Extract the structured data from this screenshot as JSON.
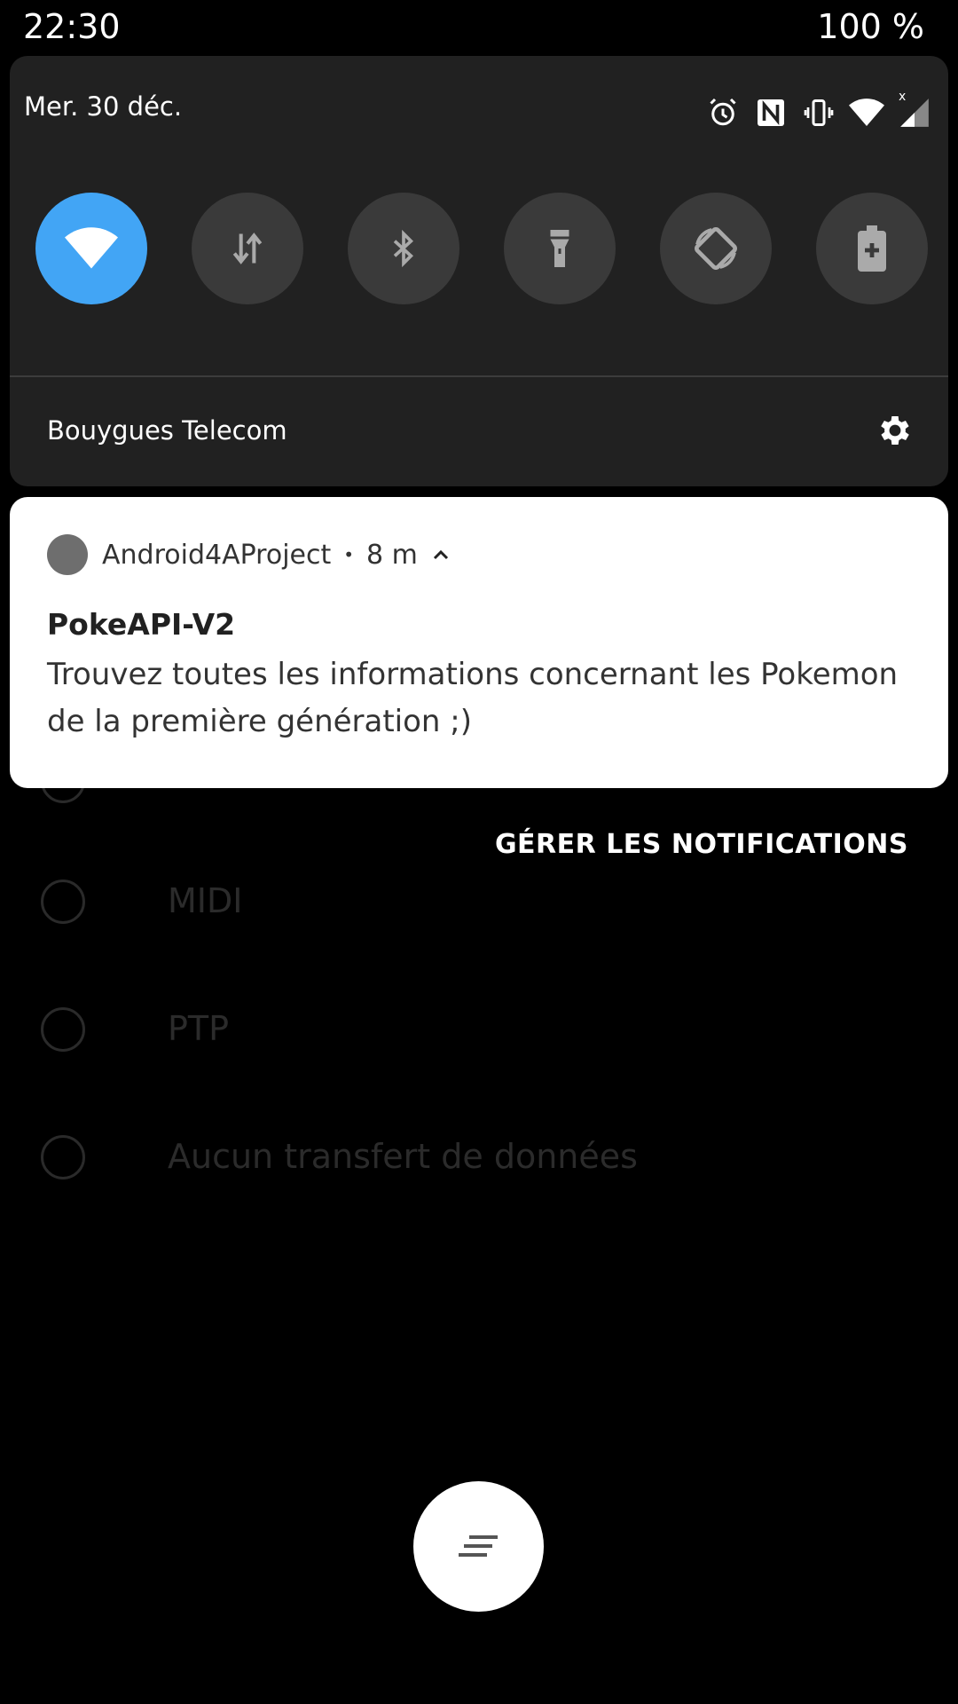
{
  "status_bar": {
    "time": "22:30",
    "battery": "100 %"
  },
  "quick_settings": {
    "date": "Mer. 30 déc.",
    "status_icons": [
      "alarm-icon",
      "nfc-icon",
      "vibrate-icon",
      "wifi-icon",
      "signal-icon"
    ],
    "tiles": [
      {
        "icon": "wifi-icon",
        "active": true
      },
      {
        "icon": "mobile-data-icon",
        "active": false
      },
      {
        "icon": "bluetooth-icon",
        "active": false
      },
      {
        "icon": "flashlight-icon",
        "active": false
      },
      {
        "icon": "auto-rotate-icon",
        "active": false
      },
      {
        "icon": "battery-saver-icon",
        "active": false
      }
    ],
    "carrier": "Bouygues Telecom",
    "settings_icon": "gear-icon",
    "accent_color": "#42a5f5"
  },
  "notification": {
    "app_name": "Android4AProject",
    "separator": "•",
    "time_ago": "8 m",
    "title": "PokeAPI-V2",
    "text": "Trouvez toutes les informations concernant les Pokemon de la première génération ;)"
  },
  "manage_button": "GÉRER LES NOTIFICATIONS",
  "background_options": [
    {
      "label": "MIDI"
    },
    {
      "label": "PTP"
    },
    {
      "label": "Aucun transfert de données"
    }
  ],
  "fab_icon": "menu-lines-icon"
}
